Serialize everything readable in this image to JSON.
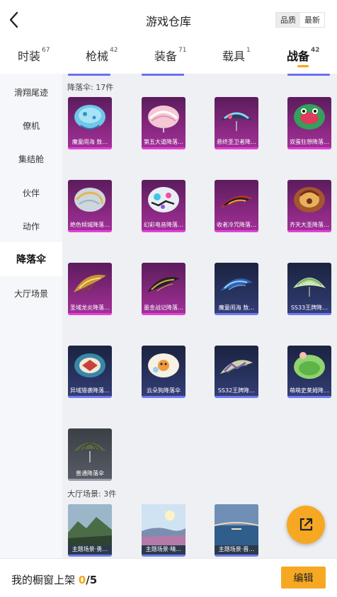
{
  "header": {
    "title": "游戏仓库",
    "sort_options": [
      "品质",
      "最新"
    ]
  },
  "tabs": [
    {
      "label": "时装",
      "count": "67"
    },
    {
      "label": "枪械",
      "count": "42"
    },
    {
      "label": "装备",
      "count": "71"
    },
    {
      "label": "载具",
      "count": "1"
    },
    {
      "label": "战备",
      "count": "42",
      "active": true
    }
  ],
  "sidebar": {
    "items": [
      "滑翔尾迹",
      "僚机",
      "集结舱",
      "伙伴",
      "动作",
      "降落伞",
      "大厅场景"
    ],
    "active": "降落伞"
  },
  "parachute_section": {
    "label": "降落伞: 17件",
    "items": [
      {
        "name": "魔童闹海 敖…",
        "rarity": "purple",
        "icon": "jellyfish-parachute"
      },
      {
        "name": "第五大道降落…",
        "rarity": "purple",
        "icon": "pink-parachute"
      },
      {
        "name": "悬终圣卫者降…",
        "rarity": "purple",
        "icon": "guardian-parachute"
      },
      {
        "name": "双蛋狂想降落…",
        "rarity": "purple",
        "icon": "green-monster-parachute"
      },
      {
        "name": "绝色倾城降落…",
        "rarity": "purple",
        "icon": "silver-parachute"
      },
      {
        "name": "幻彩电音降落…",
        "rarity": "purple",
        "icon": "graffiti-parachute"
      },
      {
        "name": "收者冷咒降落…",
        "rarity": "purple",
        "icon": "red-curse-parachute"
      },
      {
        "name": "齐天大圣降落…",
        "rarity": "purple",
        "icon": "monkey-king-parachute"
      },
      {
        "name": "圣域龙炎降落…",
        "rarity": "purple",
        "icon": "golden-dragon-parachute"
      },
      {
        "name": "墨金战记降落…",
        "rarity": "purple",
        "icon": "black-gold-parachute"
      },
      {
        "name": "魔童闹海 敖…",
        "rarity": "blue",
        "icon": "blue-wave-parachute"
      },
      {
        "name": "SS33王牌降…",
        "rarity": "blue",
        "icon": "ss33-parachute"
      },
      {
        "name": "异域猎袭降落…",
        "rarity": "blue",
        "icon": "tribal-parachute"
      },
      {
        "name": "云朵狗降落伞",
        "rarity": "blue",
        "icon": "cloud-dog-parachute"
      },
      {
        "name": "SS32王牌降…",
        "rarity": "blue",
        "icon": "ss32-parachute"
      },
      {
        "name": "萌萌史莱姆降…",
        "rarity": "blue",
        "icon": "slime-parachute"
      },
      {
        "name": "普通降落伞",
        "rarity": "grey",
        "icon": "standard-parachute"
      }
    ]
  },
  "lobby_section": {
    "label": "大厅场景: 3件",
    "items": [
      {
        "name": "主题场景·勇…",
        "icon": "mountain-scene"
      },
      {
        "name": "主题场景·晴…",
        "icon": "sunny-scene"
      },
      {
        "name": "主题场景·晋…",
        "icon": "sea-scene"
      }
    ]
  },
  "share_button": {
    "icon": "share-icon"
  },
  "footer": {
    "showcase_label": "我的橱窗上架",
    "showcase_count": "0",
    "showcase_total": "/5",
    "edit_label": "编辑"
  },
  "colors": {
    "accent": "#f7a823",
    "purple_rarity": "#e43fd8",
    "blue_rarity": "#7278f2",
    "grey_rarity": "#9aa0ab"
  }
}
